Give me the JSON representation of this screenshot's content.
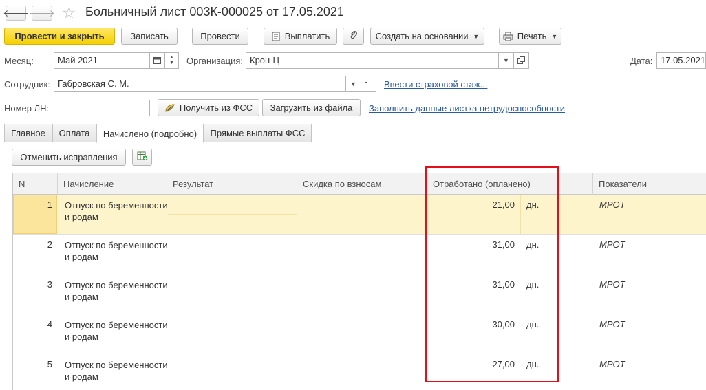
{
  "window": {
    "title": "Больничный лист 003К-000025 от 17.05.2021"
  },
  "toolbar": {
    "post_close": "Провести и закрыть",
    "save": "Записать",
    "post": "Провести",
    "pay": "Выплатить",
    "create_based": "Создать на основании",
    "print": "Печать"
  },
  "form": {
    "month_label": "Месяц:",
    "month_value": "Май 2021",
    "org_label": "Организация:",
    "org_value": "Крон-Ц",
    "date_label": "Дата:",
    "date_value": "17.05.2021",
    "employee_label": "Сотрудник:",
    "employee_value": "Габровская С. М.",
    "insurance_link": "Ввести страховой стаж...",
    "ln_label": "Номер ЛН:",
    "ln_value": "",
    "get_fss": "Получить из ФСС",
    "load_file": "Загрузить из файла",
    "fill_link": "Заполнить данные листка нетрудоспособности"
  },
  "tabs": [
    {
      "label": "Главное"
    },
    {
      "label": "Оплата"
    },
    {
      "label": "Начислено (подробно)"
    },
    {
      "label": "Прямые выплаты ФСС"
    }
  ],
  "active_tab": "Начислено (подробно)",
  "cancel_corrections": "Отменить исправления",
  "table": {
    "columns": [
      "N",
      "Начисление",
      "Результат",
      "Скидка по взносам",
      "Отработано (оплачено)",
      "Показатели"
    ],
    "rows": [
      {
        "n": "1",
        "accrual": "Отпуск по беременности и родам",
        "worked": "21,00",
        "unit": "дн.",
        "indicator": "МРОТ"
      },
      {
        "n": "2",
        "accrual": "Отпуск по беременности и родам",
        "worked": "31,00",
        "unit": "дн.",
        "indicator": "МРОТ"
      },
      {
        "n": "3",
        "accrual": "Отпуск по беременности и родам",
        "worked": "31,00",
        "unit": "дн.",
        "indicator": "МРОТ"
      },
      {
        "n": "4",
        "accrual": "Отпуск по беременности и родам",
        "worked": "30,00",
        "unit": "дн.",
        "indicator": "МРОТ"
      },
      {
        "n": "5",
        "accrual": "Отпуск по беременности и родам",
        "worked": "27,00",
        "unit": "дн.",
        "indicator": "МРОТ"
      }
    ]
  },
  "colors": {
    "primary_button": "#f5d000",
    "selected_row": "#fdf4cc",
    "highlight_box": "#e3101a",
    "link": "#2a5a9f"
  },
  "icons": [
    "back-arrow-icon",
    "forward-arrow-icon",
    "favorite-star-icon",
    "payment-icon",
    "paperclip-icon",
    "printer-icon",
    "calendar-icon",
    "open-icon",
    "fss-icon",
    "table-settings-icon"
  ]
}
